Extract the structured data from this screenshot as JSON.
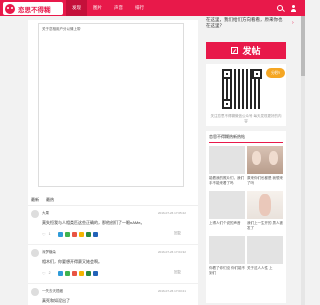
{
  "header": {
    "logo_text": "恋思不得糊",
    "nav": [
      "发现",
      "图片",
      "声音",
      "排行"
    ],
    "brand_color": "#e8194a"
  },
  "main": {
    "post_caption": "关于恋相用户分以情上带",
    "tabs": [
      "最新",
      "最热"
    ],
    "comments": [
      {
        "name": "大果",
        "time": "2016-07-26 17:05:22",
        "text": "莫失恒我与人相类匹这些正确的，那他创们了一眼nAMe。",
        "likes": "1"
      },
      {
        "name": "深梦糖朵",
        "time": "2016-07-26 17:04:32",
        "text": "相木们，你要想开得赛又她会啊。",
        "likes": "2"
      },
      {
        "name": "一失去天梧藏",
        "time": "2016-07-26 17:03:21",
        "text": "真死和如泥出了",
        "likes": "1"
      }
    ],
    "like_symbol": "♡",
    "reply_label": "回复"
  },
  "sidebar": {
    "promo_text": "在这里，我们给们方向看看，原来你也在这里？",
    "promo_arrow": "›",
    "post_button": "发帖",
    "qr_badge": "分秒!",
    "qr_caption": "关注恋思不得糊微信公众号 每天发现更好的内容",
    "hot_title": "恋思不得糊热新热帖",
    "hot_items": [
      {
        "label": "能看我的照片们，我们 手不能来看了吗",
        "thumb": "plain"
      },
      {
        "label": "原来你们也都是 我想来了吗",
        "thumb": "face"
      },
      {
        "label": "上得人们个说的声音",
        "thumb": "plain"
      },
      {
        "label": "我们上一生开的 男人被发了",
        "thumb": "body"
      },
      {
        "label": "你看了你们没 你们能不到们",
        "thumb": "plain"
      },
      {
        "label": "关于这人人性 上",
        "thumb": "plain"
      }
    ]
  }
}
